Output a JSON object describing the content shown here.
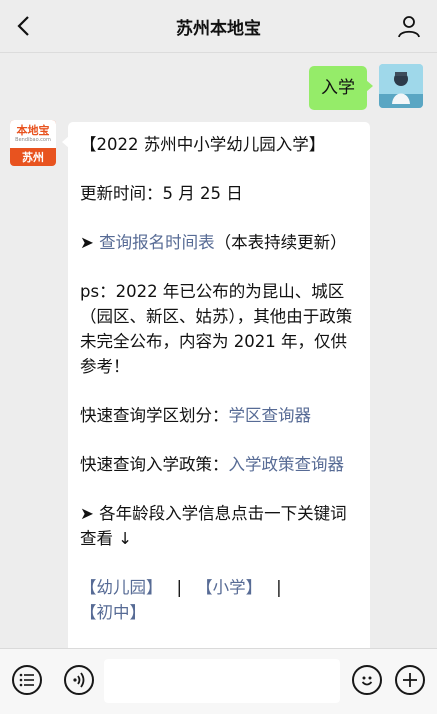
{
  "header": {
    "title": "苏州本地宝",
    "back_icon": "chevron-left-icon",
    "profile_icon": "person-icon"
  },
  "messages": {
    "outgoing": {
      "text": "入学"
    },
    "bot_avatar": {
      "brand": "本地宝",
      "site": "Bendibao.com",
      "city": "苏州"
    },
    "incoming": {
      "title": "【2022 苏州中小学幼儿园入学】",
      "update": "更新时间：5 月 25 日",
      "schedule_arrow": "➤ ",
      "schedule_link": "查询报名时间表",
      "schedule_note": "（本表持续更新）",
      "ps": "ps：2022 年已公布的为昆山、城区（园区、新区、姑苏），其他由于政策未完全公布，内容为 2021 年，仅供参考！",
      "district_label": "快速查询学区划分：",
      "district_link": "学区查询器",
      "policy_label": "快速查询入学政策：",
      "policy_link": "入学政策查询器",
      "keywords_hint": "➤ 各年龄段入学信息点击一下关键词查看 ↓",
      "keywords": [
        "【幼儿园】",
        "【小学】",
        "【初中】"
      ],
      "separator": "|"
    }
  },
  "input_bar": {
    "voice_icon": "voice-icon",
    "menu_icon": "list-menu-icon",
    "emoji_icon": "emoji-icon",
    "plus_icon": "plus-icon",
    "placeholder": ""
  },
  "colors": {
    "background": "#ededed",
    "outgoing_bubble": "#95ec69",
    "link": "#576b95",
    "brand": "#e8531f"
  }
}
